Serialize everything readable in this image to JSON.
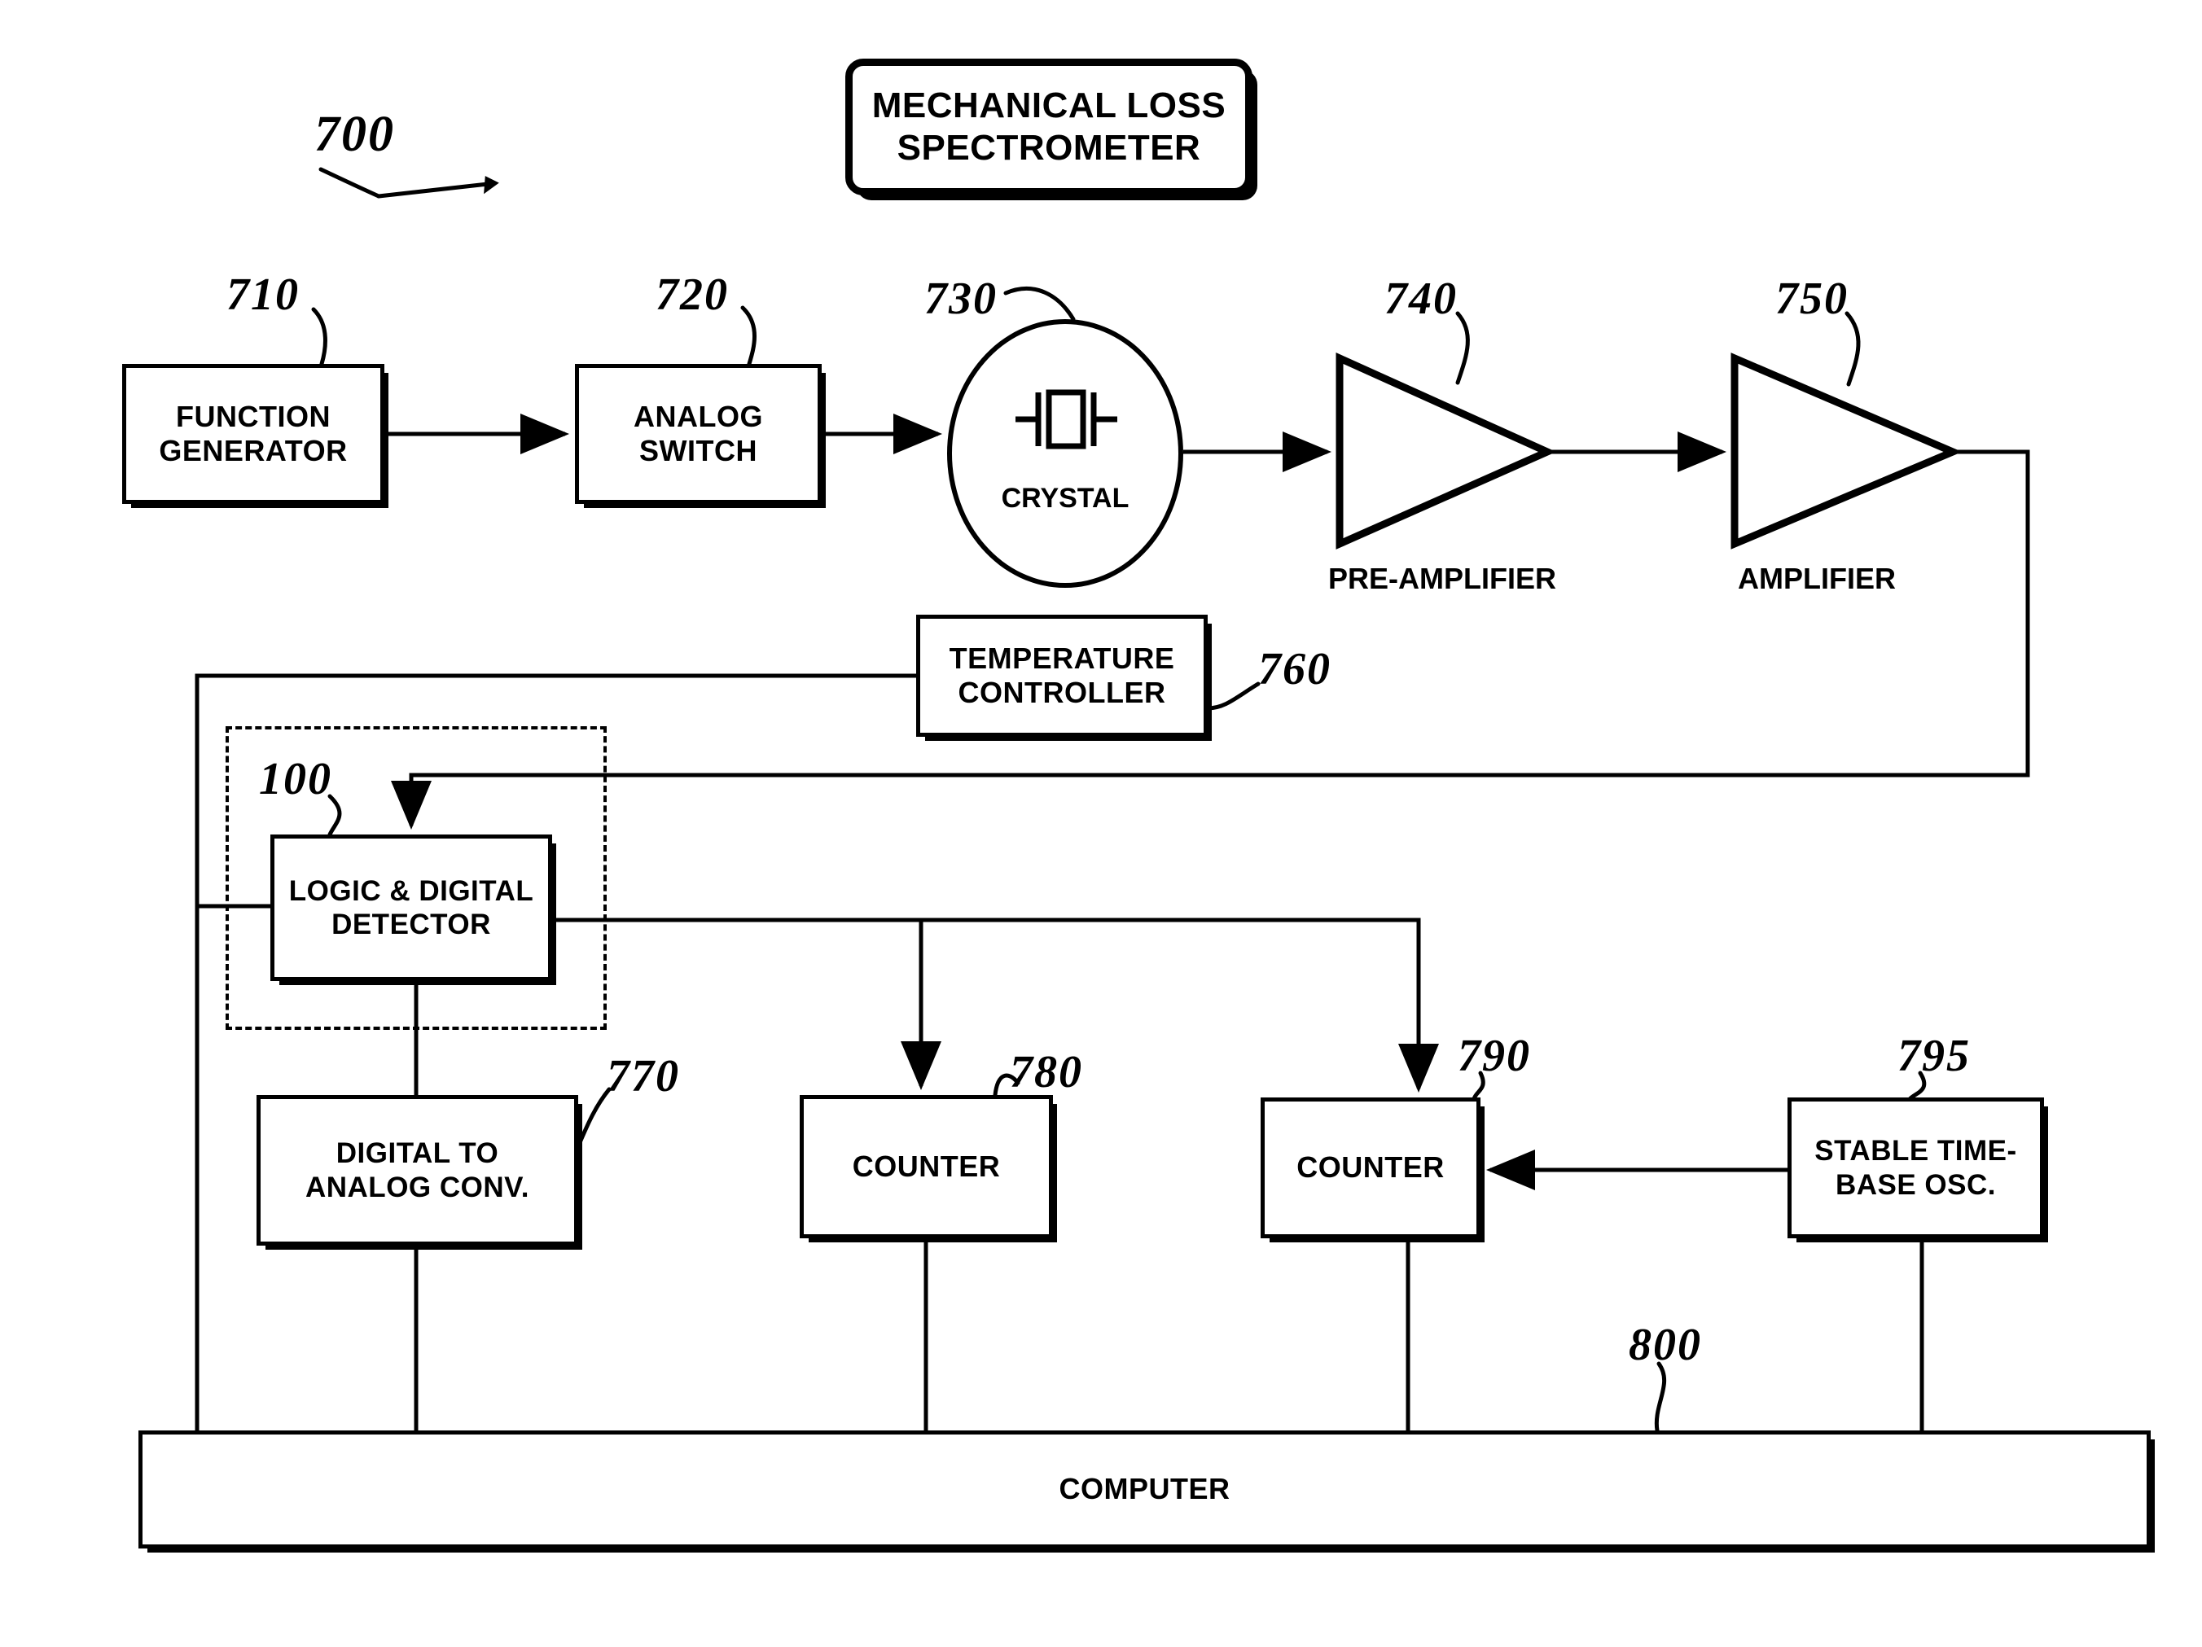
{
  "figure": {
    "number": "700",
    "title_line1": "MECHANICAL LOSS",
    "title_line2": "SPECTROMETER"
  },
  "blocks": [
    {
      "id": "function-generator",
      "ref": "710",
      "line1": "FUNCTION",
      "line2": "GENERATOR"
    },
    {
      "id": "analog-switch",
      "ref": "720",
      "line1": "ANALOG",
      "line2": "SWITCH"
    },
    {
      "id": "crystal",
      "ref": "730",
      "label": "CRYSTAL"
    },
    {
      "id": "pre-amplifier",
      "ref": "740",
      "label": "PRE-AMPLIFIER"
    },
    {
      "id": "amplifier",
      "ref": "750",
      "label": "AMPLIFIER"
    },
    {
      "id": "temperature-controller",
      "ref": "760",
      "line1": "TEMPERATURE",
      "line2": "CONTROLLER"
    },
    {
      "id": "logic-digital-detector",
      "ref": "100",
      "line1": "LOGIC & DIGITAL",
      "line2": "DETECTOR"
    },
    {
      "id": "digital-to-analog-converter",
      "ref": "770",
      "line1": "DIGITAL TO",
      "line2": "ANALOG CONV."
    },
    {
      "id": "counter-1",
      "ref": "780",
      "label": "COUNTER"
    },
    {
      "id": "counter-2",
      "ref": "790",
      "label": "COUNTER"
    },
    {
      "id": "stable-timebase-oscillator",
      "ref": "795",
      "line1": "STABLE TIME-",
      "line2": "BASE OSC."
    },
    {
      "id": "computer",
      "ref": "800",
      "label": "COMPUTER"
    }
  ],
  "colors": {
    "ink": "#000000",
    "paper": "#ffffff"
  }
}
